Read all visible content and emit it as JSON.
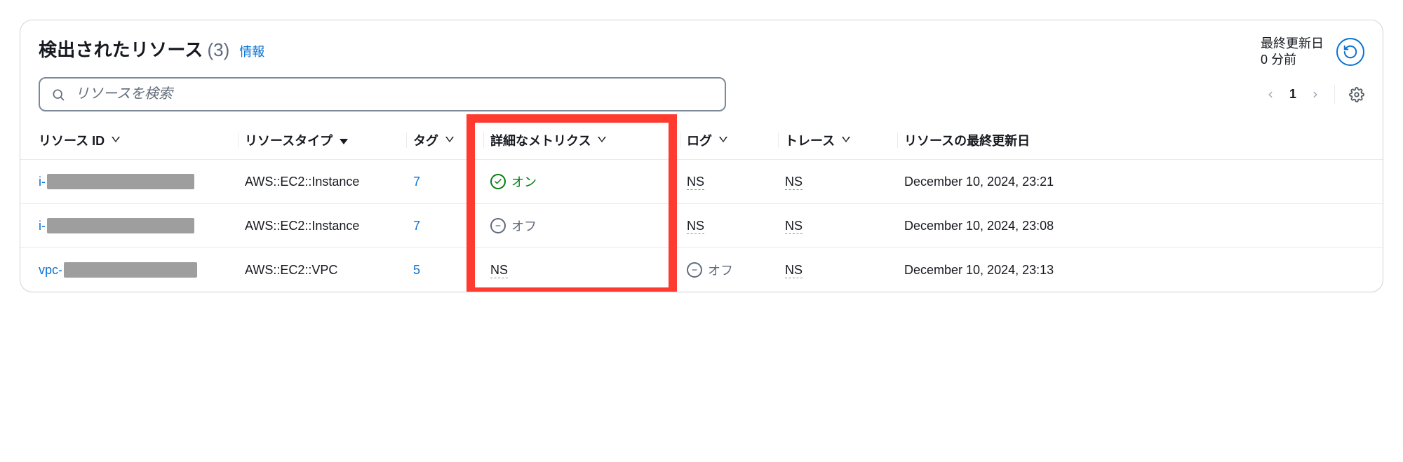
{
  "header": {
    "title": "検出されたリソース",
    "count": "(3)",
    "info_link": "情報",
    "last_updated_label": "最終更新日",
    "last_updated_value": "0 分前"
  },
  "search": {
    "placeholder": "リソースを検索"
  },
  "pagination": {
    "page": "1"
  },
  "columns": {
    "resource_id": "リソース ID",
    "resource_type": "リソースタイプ",
    "tag": "タグ",
    "detailed_metrics": "詳細なメトリクス",
    "log": "ログ",
    "trace": "トレース",
    "last_updated": "リソースの最終更新日"
  },
  "status_labels": {
    "on": "オン",
    "off": "オフ",
    "ns": "NS"
  },
  "rows": [
    {
      "id_prefix": "i-",
      "redact_width": 210,
      "type": "AWS::EC2::Instance",
      "tag": "7",
      "metrics": "on",
      "log": "ns",
      "trace": "ns",
      "updated": "December 10, 2024, 23:21"
    },
    {
      "id_prefix": "i-",
      "redact_width": 210,
      "type": "AWS::EC2::Instance",
      "tag": "7",
      "metrics": "off",
      "log": "ns",
      "trace": "ns",
      "updated": "December 10, 2024, 23:08"
    },
    {
      "id_prefix": "vpc-",
      "redact_width": 190,
      "type": "AWS::EC2::VPC",
      "tag": "5",
      "metrics": "ns",
      "log": "off",
      "trace": "ns",
      "updated": "December 10, 2024, 23:13"
    }
  ],
  "highlight": {
    "column_index": 3
  }
}
